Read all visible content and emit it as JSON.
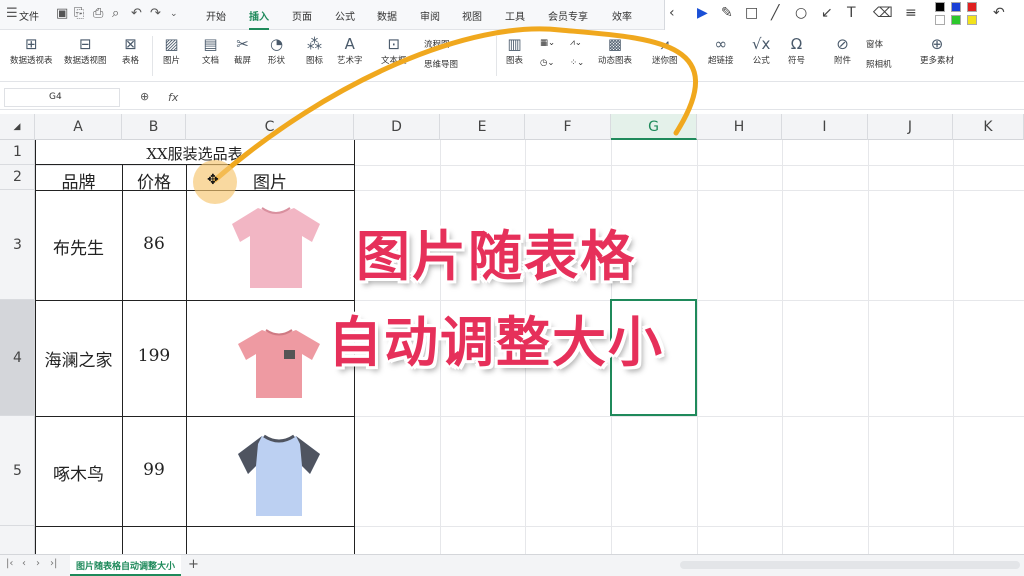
{
  "menubar": {
    "file_label": "文件",
    "tabs": [
      "开始",
      "插入",
      "页面",
      "公式",
      "数据",
      "审阅",
      "视图",
      "工具",
      "会员专享",
      "效率"
    ],
    "active_tab": "插入"
  },
  "ribbon": {
    "buttons": [
      "数据透视表",
      "数据透视图",
      "表格",
      "图片",
      "文档",
      "截屏",
      "形状",
      "图标",
      "艺术字",
      "文本框",
      "图表",
      "动态图表",
      "迷你图",
      "超链接",
      "公式",
      "符号",
      "附件",
      "更多素材"
    ],
    "small_items": [
      "流程图",
      "思维导图",
      "窗体",
      "照相机"
    ]
  },
  "formula_bar": {
    "name_box": "G4",
    "fx_label": "fx"
  },
  "grid": {
    "columns": [
      "A",
      "B",
      "C",
      "D",
      "E",
      "F",
      "G",
      "H",
      "I",
      "J",
      "K"
    ],
    "rows": [
      "1",
      "2",
      "3",
      "4",
      "5"
    ],
    "selected_column": "G",
    "selected_row": "4"
  },
  "table": {
    "title": "XX服装选品表",
    "headers": [
      "品牌",
      "价格",
      "图片"
    ],
    "rows": [
      {
        "brand": "布先生",
        "price": "86",
        "shirt_color": "#f2b6c4"
      },
      {
        "brand": "海澜之家",
        "price": "199",
        "shirt_color": "#ee9aa2"
      },
      {
        "brand": "啄木鸟",
        "price": "99",
        "shirt_color": "#bcd0f2"
      }
    ]
  },
  "overlay": {
    "line1": "图片随表格",
    "line2": "自动调整大小",
    "color": "#e6305a",
    "arrow_color": "#f0a81e"
  },
  "sheet": {
    "tab_label": "图片随表格自动调整大小",
    "add_label": "+"
  }
}
